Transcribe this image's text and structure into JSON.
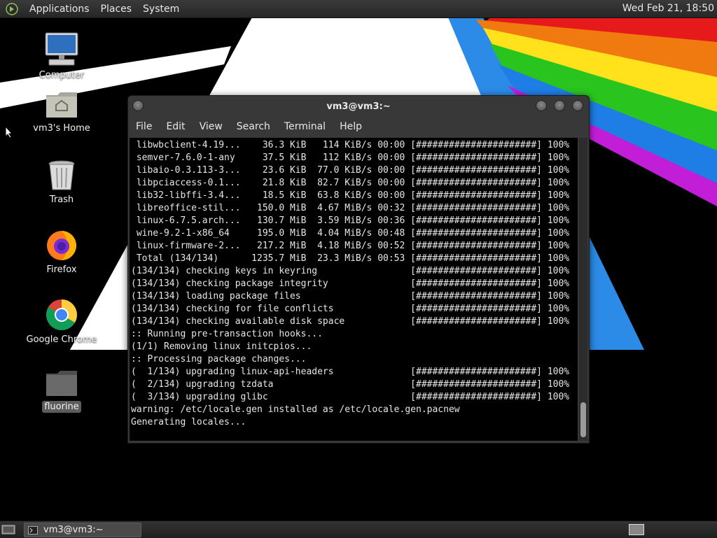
{
  "top_panel": {
    "menus": [
      "Applications",
      "Places",
      "System"
    ],
    "clock": "Wed Feb 21, 18:50"
  },
  "desktop_icons": [
    {
      "label": "Computer",
      "icon": "computer-icon"
    },
    {
      "label": "vm3's Home",
      "icon": "home-folder-icon"
    },
    {
      "label": "Trash",
      "icon": "trash-icon"
    },
    {
      "label": "Firefox",
      "icon": "firefox-icon"
    },
    {
      "label": "Google Chrome",
      "icon": "chrome-icon"
    },
    {
      "label": "fluorine",
      "icon": "folder-icon"
    }
  ],
  "terminal": {
    "title": "vm3@vm3:~",
    "menus": [
      "File",
      "Edit",
      "View",
      "Search",
      "Terminal",
      "Help"
    ],
    "lines": [
      " libwbclient-4.19...    36.3 KiB   114 KiB/s 00:00 [######################] 100%",
      " semver-7.6.0-1-any     37.5 KiB   112 KiB/s 00:00 [######################] 100%",
      " libaio-0.3.113-3...    23.6 KiB  77.0 KiB/s 00:00 [######################] 100%",
      " libpciaccess-0.1...    21.8 KiB  82.7 KiB/s 00:00 [######################] 100%",
      " lib32-libffi-3.4...    18.5 KiB  63.8 KiB/s 00:00 [######################] 100%",
      " libreoffice-stil...   150.0 MiB  4.67 MiB/s 00:32 [######################] 100%",
      " linux-6.7.5.arch...   130.7 MiB  3.59 MiB/s 00:36 [######################] 100%",
      " wine-9.2-1-x86_64     195.0 MiB  4.04 MiB/s 00:48 [######################] 100%",
      " linux-firmware-2...   217.2 MiB  4.18 MiB/s 00:52 [######################] 100%",
      " Total (134/134)      1235.7 MiB  23.3 MiB/s 00:53 [######################] 100%",
      "(134/134) checking keys in keyring                 [######################] 100%",
      "(134/134) checking package integrity               [######################] 100%",
      "(134/134) loading package files                    [######################] 100%",
      "(134/134) checking for file conflicts              [######################] 100%",
      "(134/134) checking available disk space            [######################] 100%",
      ":: Running pre-transaction hooks...",
      "(1/1) Removing linux initcpios...",
      ":: Processing package changes...",
      "(  1/134) upgrading linux-api-headers              [######################] 100%",
      "(  2/134) upgrading tzdata                         [######################] 100%",
      "(  3/134) upgrading glibc                          [######################] 100%",
      "warning: /etc/locale.gen installed as /etc/locale.gen.pacnew",
      "Generating locales..."
    ]
  },
  "taskbar": {
    "window_button": "vm3@vm3:~"
  }
}
